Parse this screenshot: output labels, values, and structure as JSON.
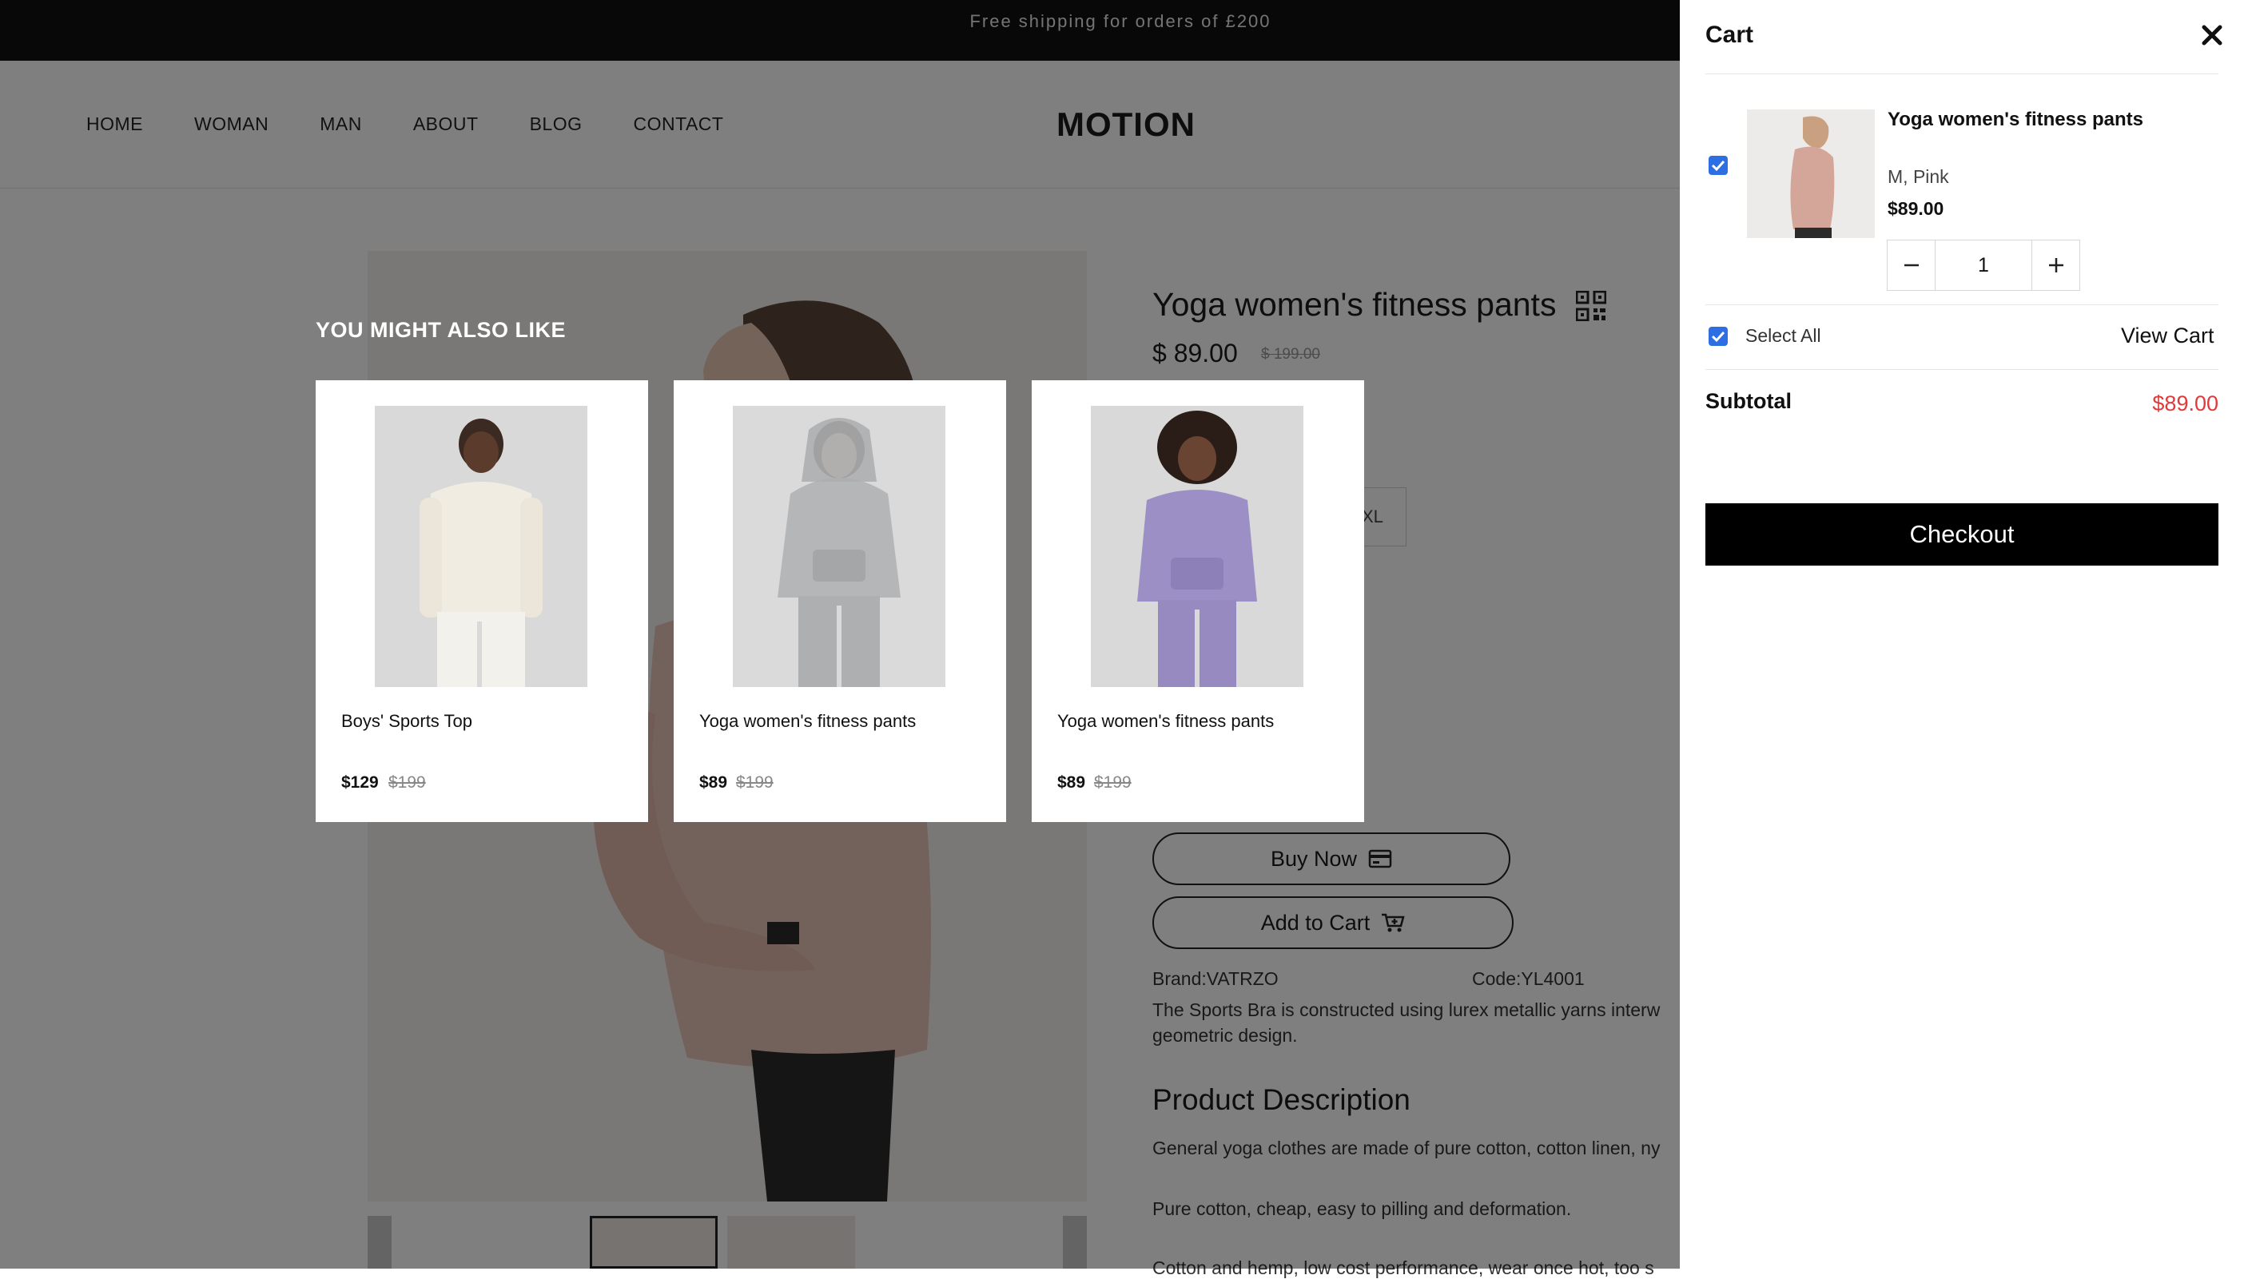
{
  "announcement": "Free shipping for orders of £200",
  "nav": {
    "links": [
      "HOME",
      "WOMAN",
      "MAN",
      "ABOUT",
      "BLOG",
      "CONTACT"
    ],
    "logo": "MOTION"
  },
  "product": {
    "title": "Yoga women's fitness pants",
    "price": "$ 89.00",
    "old_price": "$ 199.00",
    "size_visible": "XL",
    "buy_now_label": "Buy Now",
    "add_to_cart_label": "Add to Cart",
    "brand": "Brand:VATRZO",
    "code": "Code:YL4001",
    "short_description": "The Sports Bra is constructed using lurex metallic yarns interw geometric design.",
    "description_title": "Product Description",
    "description_lines": [
      "General yoga clothes are made of pure cotton, cotton linen, ny",
      "Pure cotton, cheap, easy to pilling and deformation.",
      "Cotton and hemp, low cost performance, wear once hot, too s"
    ]
  },
  "recommendations": {
    "heading": "YOU MIGHT ALSO LIKE",
    "items": [
      {
        "name": "Boys' Sports Top",
        "price": "$129",
        "old_price": "$199"
      },
      {
        "name": "Yoga women's fitness pants",
        "price": "$89",
        "old_price": "$199"
      },
      {
        "name": "Yoga women's fitness pants",
        "price": "$89",
        "old_price": "$199"
      }
    ]
  },
  "cart": {
    "title": "Cart",
    "item": {
      "name": "Yoga women's fitness pants",
      "variant": "M, Pink",
      "price": "$89.00",
      "quantity": "1",
      "checked": true
    },
    "select_all_label": "Select All",
    "view_cart_label": "View Cart",
    "subtotal_label": "Subtotal",
    "subtotal_value": "$89.00",
    "checkout_label": "Checkout"
  },
  "colors": {
    "accent_price": "#e03a3a",
    "checkbox": "#2d6fe3",
    "checkout_bg": "#000000"
  }
}
